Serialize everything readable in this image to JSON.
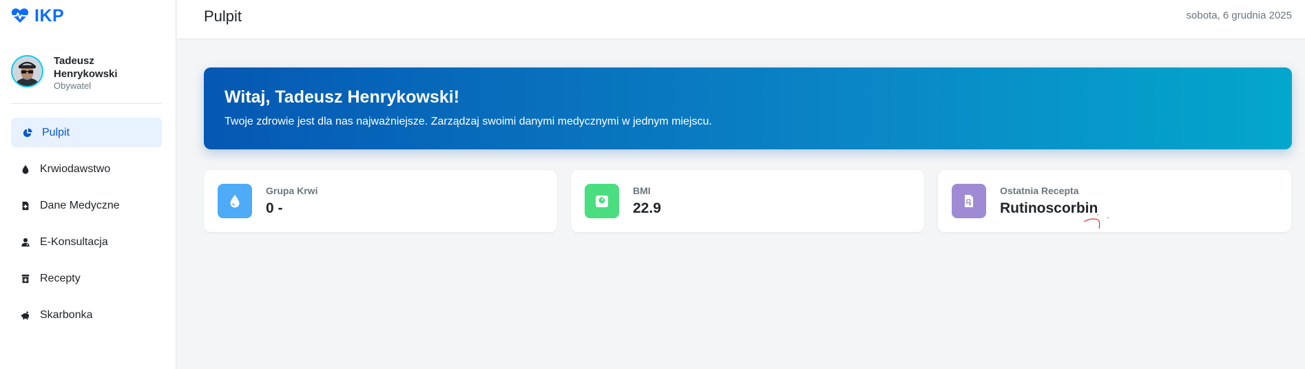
{
  "brand": {
    "name": "IKP",
    "icon": "heart-pulse-icon",
    "color": "#0d6efd"
  },
  "user": {
    "name": "Tadeusz Henrykowski",
    "role": "Obywatel"
  },
  "sidebar": {
    "items": [
      {
        "label": "Pulpit",
        "icon": "chart-pie-icon",
        "active": true
      },
      {
        "label": "Krwiodawstwo",
        "icon": "droplet-icon"
      },
      {
        "label": "Dane Medyczne",
        "icon": "file-medical-icon"
      },
      {
        "label": "E-Konsultacja",
        "icon": "user-doctor-icon"
      },
      {
        "label": "Recepty",
        "icon": "prescription-bottle-icon"
      },
      {
        "label": "Skarbonka",
        "icon": "piggy-bank-icon"
      }
    ]
  },
  "header": {
    "title": "Pulpit",
    "date": "sobota, 6 grudnia 2025"
  },
  "hero": {
    "title": "Witaj, Tadeusz Henrykowski!",
    "text": "Twoje zdrowie jest dla nas najważniejsze. Zarządzaj swoimi danymi medycznymi w jednym miejscu."
  },
  "cards": [
    {
      "label": "Grupa Krwi",
      "value": "0 -",
      "icon": "droplet-icon",
      "color": "#4dabf7"
    },
    {
      "label": "BMI",
      "value": "22.9",
      "icon": "weight-scale-icon",
      "color": "#4ade80"
    },
    {
      "label": "Ostatnia Recepta",
      "value": "Rutinoscorbin",
      "icon": "file-prescription-icon",
      "color": "#9f8bd4"
    }
  ]
}
